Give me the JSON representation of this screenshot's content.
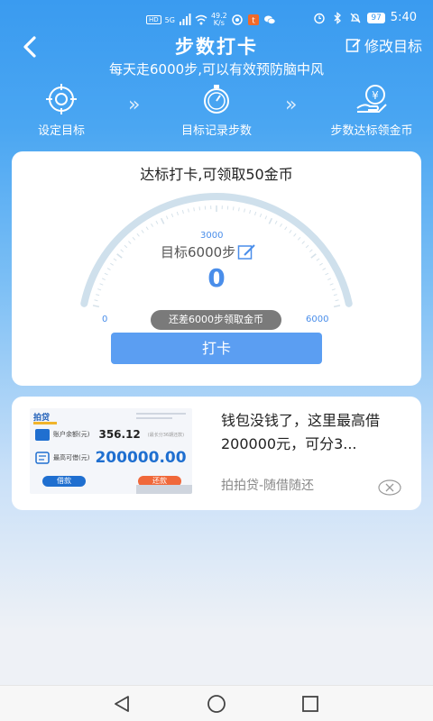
{
  "status_bar": {
    "hd": "HD",
    "network": "5G",
    "speed_value": "49.2",
    "speed_unit": "K/s",
    "battery": "97",
    "time": "5:40"
  },
  "header": {
    "title": "步数打卡",
    "edit_label": "修改目标",
    "subtitle": "每天走6000步,可以有效预防脑中风"
  },
  "steps": [
    {
      "label": "设定目标",
      "icon": "target-icon"
    },
    {
      "label": "目标记录步数",
      "icon": "stopwatch-icon"
    },
    {
      "label": "步数达标领金币",
      "icon": "coin-hand-icon"
    }
  ],
  "main_card": {
    "title": "达标打卡,可领取50金币",
    "target_label": "目标6000步",
    "current_steps": "0",
    "tick_min": "0",
    "tick_mid": "3000",
    "tick_max": "6000",
    "progress": 0,
    "tooltip": "还差6000步领取金币",
    "button_label": "打卡"
  },
  "ad": {
    "logo": "拍贷",
    "balance_label": "账户余额(元)",
    "balance_value": "356.12",
    "balance_note": "(最长分36期还款)",
    "limit_label": "最高可借(元)",
    "limit_value": "200000.00",
    "borrow_label": "借款",
    "repay_label": "还款",
    "text": "钱包没钱了，这里最高借200000元，可分3...",
    "source": "拍拍贷-随借随还"
  },
  "colors": {
    "accent": "#3a9bf0",
    "button": "#5b9ef2",
    "gauge_track": "#cfe0ec",
    "value": "#4a8eea"
  }
}
